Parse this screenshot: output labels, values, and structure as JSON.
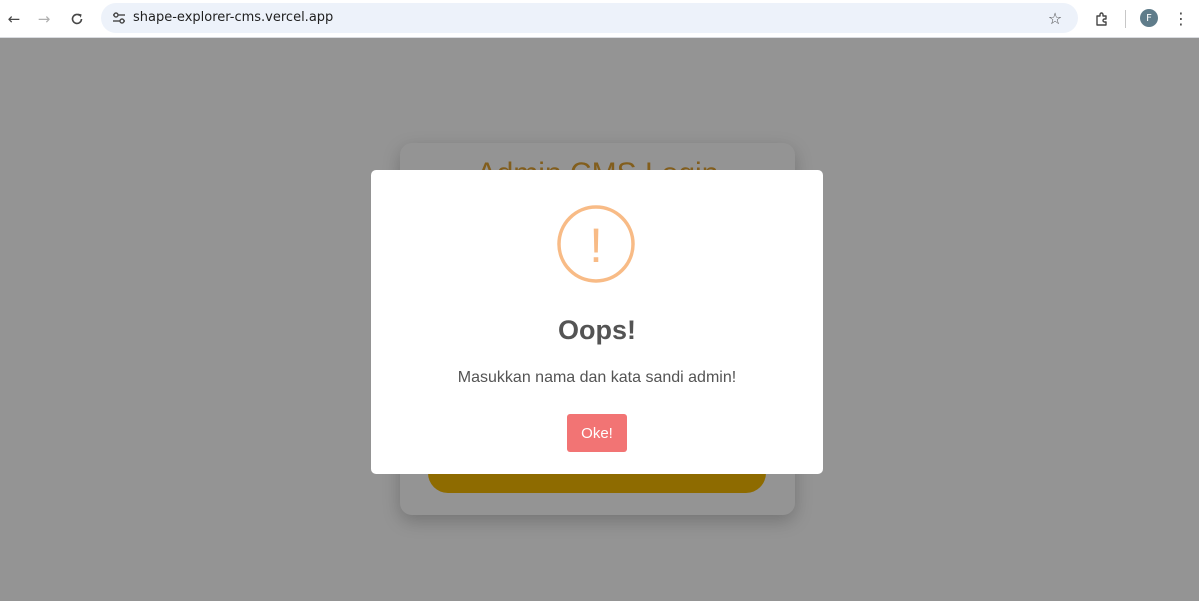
{
  "browser": {
    "url": "shape-explorer-cms.vercel.app",
    "profile_initial": "F",
    "icons": {
      "back": "←",
      "forward": "→",
      "reload": "C",
      "bookmark": "☆",
      "menu": "⋮"
    }
  },
  "page": {
    "login_title": "Admin CMS Login"
  },
  "modal": {
    "icon_glyph": "!",
    "title": "Oops!",
    "message": "Masukkan nama dan kata sandi admin!",
    "confirm_label": "Oke!"
  },
  "colors": {
    "warning": "#f8bb86",
    "confirm_button": "#f27474",
    "login_title": "#e1a233",
    "login_button": "#f5b800"
  }
}
